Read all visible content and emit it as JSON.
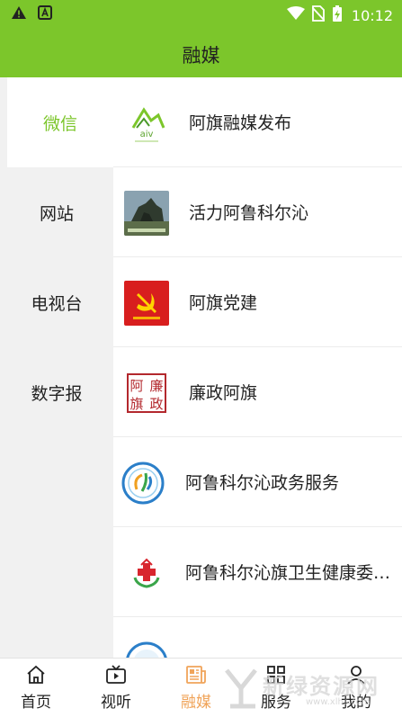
{
  "status_bar": {
    "time": "10:12",
    "icons": [
      "warning-icon",
      "app-notification-icon",
      "wifi-icon",
      "no-sim-icon",
      "battery-charging-icon"
    ]
  },
  "header": {
    "title": "融媒"
  },
  "sidebar": {
    "items": [
      {
        "label": "微信",
        "selected": true
      },
      {
        "label": "网站",
        "selected": false
      },
      {
        "label": "电视台",
        "selected": false
      },
      {
        "label": "数字报",
        "selected": false
      }
    ]
  },
  "list": {
    "items": [
      {
        "name": "阿旗融媒发布",
        "logo_text": "aiv"
      },
      {
        "name": "活力阿鲁科尔沁",
        "logo_text": ""
      },
      {
        "name": "阿旗党建",
        "logo_text": ""
      },
      {
        "name": "廉政阿旗",
        "logo_text": "阿廉旗政"
      },
      {
        "name": "阿鲁科尔沁政务服务",
        "logo_text": ""
      },
      {
        "name": "阿鲁科尔沁旗卫生健康委…",
        "logo_text": ""
      },
      {
        "name": "",
        "logo_text": ""
      }
    ]
  },
  "tab_bar": {
    "tabs": [
      {
        "label": "首页",
        "icon": "home-icon",
        "active": false
      },
      {
        "label": "视听",
        "icon": "video-icon",
        "active": false
      },
      {
        "label": "融媒",
        "icon": "newspaper-icon",
        "active": true
      },
      {
        "label": "服务",
        "icon": "grid-icon",
        "active": false
      },
      {
        "label": "我的",
        "icon": "user-icon",
        "active": false
      }
    ]
  },
  "watermark": {
    "text": "新绿资源网",
    "url": "www.xlhs.com"
  },
  "colors": {
    "brand_green": "#7cc62b",
    "active_tab": "#f0a45a",
    "sidebar_bg": "#f1f1f1"
  }
}
